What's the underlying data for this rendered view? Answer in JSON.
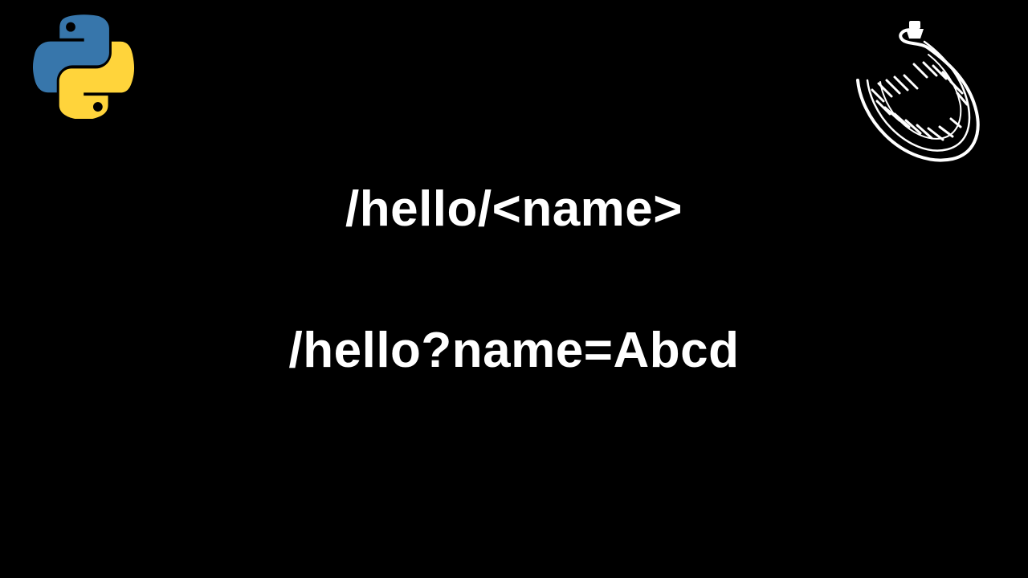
{
  "routes": {
    "path_param_example": "/hello/<name>",
    "query_param_example": "/hello?name=Abcd"
  },
  "icons": {
    "top_left": "python-logo",
    "top_right": "flask-logo"
  }
}
